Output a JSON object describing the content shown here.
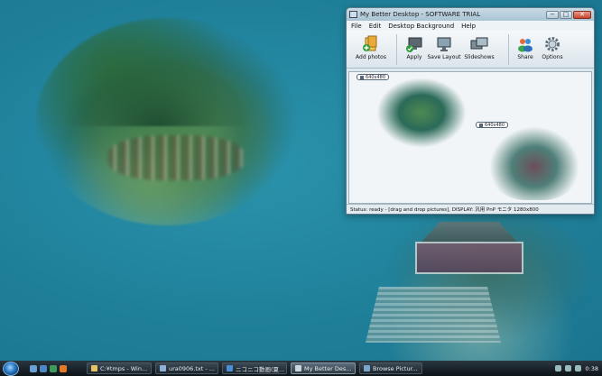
{
  "window": {
    "title": "My Better Desktop - SOFTWARE TRIAL",
    "minimize": "−",
    "maximize": "□",
    "close": "✕"
  },
  "menu": [
    "File",
    "Edit",
    "Desktop Background",
    "Help"
  ],
  "toolbar": {
    "add_photos": "Add photos",
    "apply": "Apply",
    "save_layout": "Save Layout",
    "slideshows": "Slideshows",
    "share": "Share",
    "options": "Options"
  },
  "canvas": {
    "tag_a": "640x480",
    "tag_b": "640x480"
  },
  "status": "Status: ready - [drag and drop pictures], DISPLAY: 汎用 PnP モニタ 1280x800",
  "taskbar": {
    "tasks": [
      "C:¥tmps - Win...",
      "ura0906.txt - ...",
      "ニコニコ動画(夏...",
      "My Better Des...",
      "Browse Pictur..."
    ],
    "clock": "0:38"
  },
  "colors": {
    "desktop": "#2487a1",
    "taskbar": "#0d1418",
    "accent": "#2a77c3"
  }
}
